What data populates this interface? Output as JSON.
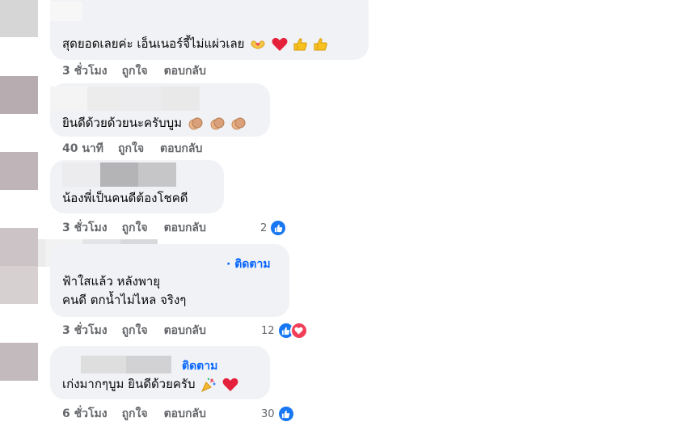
{
  "comments": [
    {
      "text": "สุดยอดเลยค่ะ เอ็นเนอร์จี้ไม่แผ่วเลย",
      "emoji_icons": [
        "heart-hands-icon",
        "red-heart-icon",
        "thumbs-up-icon",
        "thumbs-up-icon"
      ],
      "time": "3 ชั่วโมง",
      "like_label": "ถูกใจ",
      "reply_label": "ตอบกลับ"
    },
    {
      "text": "ยินดีด้วยด้วยนะครับบูม",
      "emoji_icons": [
        "clapping-hands-icon",
        "clapping-hands-icon",
        "clapping-hands-icon"
      ],
      "time": "40 นาที",
      "like_label": "ถูกใจ",
      "reply_label": "ตอบกลับ"
    },
    {
      "text": "น้องพี่เป็นคนดีต้องโชคดี",
      "emoji_icons": [],
      "time": "3 ชั่วโมง",
      "like_label": "ถูกใจ",
      "reply_label": "ตอบกลับ",
      "reaction_count": "2",
      "reaction_icons": [
        "like-reaction-icon"
      ]
    },
    {
      "follow_label": "· ติดตาม",
      "text_line1": "ฟ้าใสแล้ว หลังพายุ",
      "text_line2": "คนดี ตกน้ำไม่ไหล จริงๆ",
      "time": "3 ชั่วโมง",
      "like_label": "ถูกใจ",
      "reply_label": "ตอบกลับ",
      "reaction_count": "12",
      "reaction_icons": [
        "like-reaction-icon",
        "love-reaction-icon"
      ]
    },
    {
      "follow_label": "ติดตาม",
      "text": "เก่งมากๆบูม ยินดีด้วยครับ",
      "emoji_icons": [
        "party-popper-icon",
        "red-heart-icon"
      ],
      "time": "6 ชั่วโมง",
      "like_label": "ถูกใจ",
      "reply_label": "ตอบกลับ",
      "reaction_count": "30",
      "reaction_icons": [
        "like-reaction-icon"
      ]
    }
  ],
  "colors": {
    "bubble": "#f0f2f5",
    "link": "#0866ff",
    "meta": "#65676b",
    "like_blue": "#1877f2",
    "love_red": "#f33e58"
  }
}
